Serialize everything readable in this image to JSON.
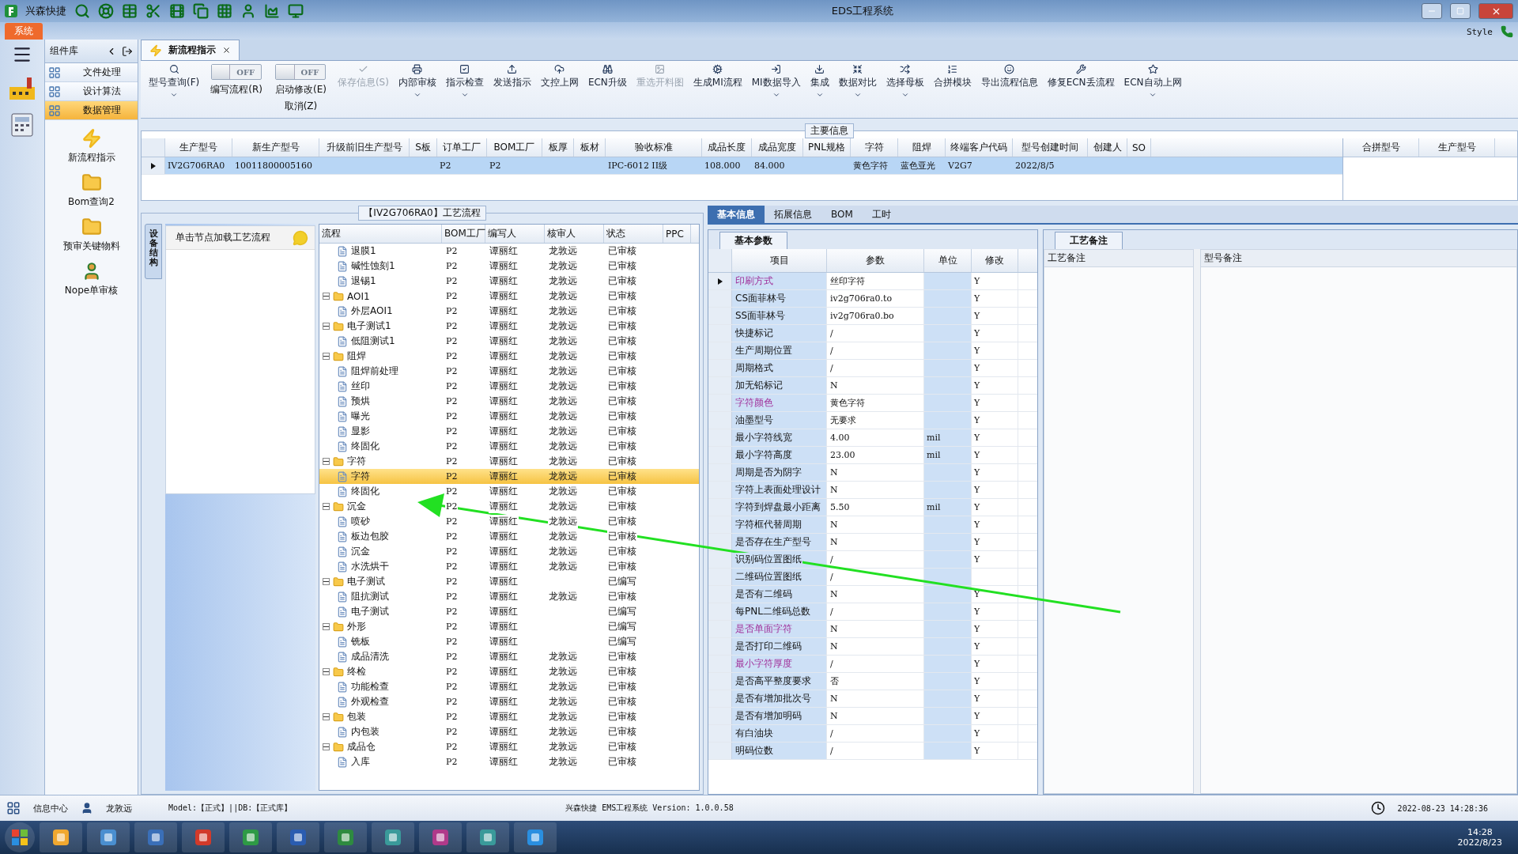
{
  "title_bar": {
    "app_name": "兴森快捷",
    "title": "EDS工程系统"
  },
  "ribbon": {
    "tab": "系统",
    "style_label": "Style"
  },
  "component_panel": {
    "title": "组件库",
    "menu": [
      {
        "label": "文件处理",
        "selected": false
      },
      {
        "label": "设计算法",
        "selected": false
      },
      {
        "label": "数据管理",
        "selected": true
      }
    ],
    "tools": [
      {
        "label": "新流程指示"
      },
      {
        "label": "Bom查询2"
      },
      {
        "label": "预审关键物料"
      },
      {
        "label": "Nope单审核"
      }
    ]
  },
  "doc_tab": {
    "label": "新流程指示"
  },
  "toolbar": [
    {
      "kind": "button",
      "label": "型号查询(F)",
      "dropdown": true,
      "disabled": false
    },
    {
      "kind": "toggle",
      "label": "编写流程(R)",
      "state_text": "OFF",
      "on": false
    },
    {
      "kind": "toggle",
      "label": "启动修改(E)",
      "sublabel": "取消(Z)",
      "state_text": "OFF",
      "on": false
    },
    {
      "kind": "button",
      "label": "保存信息(S)",
      "dropdown": false,
      "disabled": true
    },
    {
      "kind": "button",
      "label": "内部审核",
      "dropdown": true,
      "disabled": false
    },
    {
      "kind": "button",
      "label": "指示检查",
      "dropdown": true,
      "disabled": false
    },
    {
      "kind": "button",
      "label": "发送指示",
      "dropdown": false,
      "disabled": false
    },
    {
      "kind": "button",
      "label": "文控上网",
      "dropdown": false,
      "disabled": false
    },
    {
      "kind": "button",
      "label": "ECN升级",
      "dropdown": false,
      "disabled": false
    },
    {
      "kind": "button",
      "label": "重选开料图",
      "dropdown": false,
      "disabled": true
    },
    {
      "kind": "button",
      "label": "生成MI流程",
      "dropdown": false,
      "disabled": false
    },
    {
      "kind": "button",
      "label": "MI数据导入",
      "dropdown": true,
      "disabled": false
    },
    {
      "kind": "button",
      "label": "集成",
      "dropdown": true,
      "disabled": false
    },
    {
      "kind": "button",
      "label": "数据对比",
      "dropdown": true,
      "disabled": false
    },
    {
      "kind": "button",
      "label": "选择母板",
      "dropdown": true,
      "disabled": false
    },
    {
      "kind": "button",
      "label": "合拼模块",
      "dropdown": false,
      "disabled": false
    },
    {
      "kind": "button",
      "label": "导出流程信息",
      "dropdown": false,
      "disabled": false
    },
    {
      "kind": "button",
      "label": "修复ECN丢流程",
      "dropdown": false,
      "disabled": false
    },
    {
      "kind": "button",
      "label": "ECN自动上网",
      "dropdown": true,
      "disabled": false
    }
  ],
  "main_info": {
    "title": "主要信息",
    "columns": [
      "生产型号",
      "新生产型号",
      "升级前旧生产型号",
      "S板",
      "订单工厂",
      "BOM工厂",
      "板厚",
      "板材",
      "验收标准",
      "成品长度",
      "成品宽度",
      "PNL规格",
      "字符",
      "阻焊",
      "终端客户代码",
      "型号创建时间",
      "创建人",
      "SO"
    ],
    "rows": [
      {
        "selected": true,
        "cells": [
          "IV2G706RA0",
          "10011800005160",
          null,
          null,
          "P2",
          "P2",
          null,
          null,
          "IPC-6012 II级",
          "108.000",
          "84.000",
          null,
          "黄色字符",
          "蓝色亚光",
          "V2G7",
          "2022/8/5",
          null,
          null
        ]
      }
    ],
    "side_columns": [
      "合拼型号",
      "生产型号"
    ]
  },
  "process_panel": {
    "title": "【IV2G706RA0】工艺流程",
    "side_tab": "设备结构",
    "hint": "单击节点加载工艺流程",
    "columns": [
      "流程",
      "BOM工厂",
      "编写人",
      "核审人",
      "状态",
      "PPC"
    ],
    "nodes": [
      {
        "kind": "continuation",
        "children": [
          {
            "label": "退膜1",
            "bom": "P2",
            "writer": "谭丽红",
            "reviewer": "龙敦远",
            "status": "已审核",
            "selected": false
          },
          {
            "label": "碱性蚀刻1",
            "bom": "P2",
            "writer": "谭丽红",
            "reviewer": "龙敦远",
            "status": "已审核",
            "selected": false
          },
          {
            "label": "退锡1",
            "bom": "P2",
            "writer": "谭丽红",
            "reviewer": "龙敦远",
            "status": "已审核",
            "selected": false
          }
        ]
      },
      {
        "kind": "folder",
        "label": "AOI1",
        "bom": "P2",
        "writer": "谭丽红",
        "reviewer": "龙敦远",
        "status": "已审核",
        "selected": false,
        "expanded": true,
        "children": [
          {
            "label": "外层AOI1",
            "bom": "P2",
            "writer": "谭丽红",
            "reviewer": "龙敦远",
            "status": "已审核",
            "selected": false
          }
        ]
      },
      {
        "kind": "folder",
        "label": "电子测试1",
        "bom": "P2",
        "writer": "谭丽红",
        "reviewer": "龙敦远",
        "status": "已审核",
        "selected": false,
        "expanded": true,
        "children": [
          {
            "label": "低阻测试1",
            "bom": "P2",
            "writer": "谭丽红",
            "reviewer": "龙敦远",
            "status": "已审核",
            "selected": false
          }
        ]
      },
      {
        "kind": "folder",
        "label": "阻焊",
        "bom": "P2",
        "writer": "谭丽红",
        "reviewer": "龙敦远",
        "status": "已审核",
        "selected": false,
        "expanded": true,
        "children": [
          {
            "label": "阻焊前处理",
            "bom": "P2",
            "writer": "谭丽红",
            "reviewer": "龙敦远",
            "status": "已审核",
            "selected": false
          },
          {
            "label": "丝印",
            "bom": "P2",
            "writer": "谭丽红",
            "reviewer": "龙敦远",
            "status": "已审核",
            "selected": false
          },
          {
            "label": "预烘",
            "bom": "P2",
            "writer": "谭丽红",
            "reviewer": "龙敦远",
            "status": "已审核",
            "selected": false
          },
          {
            "label": "曝光",
            "bom": "P2",
            "writer": "谭丽红",
            "reviewer": "龙敦远",
            "status": "已审核",
            "selected": false
          },
          {
            "label": "显影",
            "bom": "P2",
            "writer": "谭丽红",
            "reviewer": "龙敦远",
            "status": "已审核",
            "selected": false
          },
          {
            "label": "终固化",
            "bom": "P2",
            "writer": "谭丽红",
            "reviewer": "龙敦远",
            "status": "已审核",
            "selected": false
          }
        ]
      },
      {
        "kind": "folder",
        "label": "字符",
        "bom": "P2",
        "writer": "谭丽红",
        "reviewer": "龙敦远",
        "status": "已审核",
        "selected": false,
        "expanded": true,
        "children": [
          {
            "label": "字符",
            "bom": "P2",
            "writer": "谭丽红",
            "reviewer": "龙敦远",
            "status": "已审核",
            "selected": true
          },
          {
            "label": "终固化",
            "bom": "P2",
            "writer": "谭丽红",
            "reviewer": "龙敦远",
            "status": "已审核",
            "selected": false
          }
        ]
      },
      {
        "kind": "folder",
        "label": "沉金",
        "bom": "P2",
        "writer": "谭丽红",
        "reviewer": "龙敦远",
        "status": "已审核",
        "selected": false,
        "expanded": true,
        "children": [
          {
            "label": "喷砂",
            "bom": "P2",
            "writer": "谭丽红",
            "reviewer": "龙敦远",
            "status": "已审核",
            "selected": false
          },
          {
            "label": "板边包胶",
            "bom": "P2",
            "writer": "谭丽红",
            "reviewer": "龙敦远",
            "status": "已审核",
            "selected": false
          },
          {
            "label": "沉金",
            "bom": "P2",
            "writer": "谭丽红",
            "reviewer": "龙敦远",
            "status": "已审核",
            "selected": false
          },
          {
            "label": "水洗烘干",
            "bom": "P2",
            "writer": "谭丽红",
            "reviewer": "龙敦远",
            "status": "已审核",
            "selected": false
          }
        ]
      },
      {
        "kind": "folder",
        "label": "电子测试",
        "bom": "P2",
        "writer": "谭丽红",
        "status": "已编写",
        "selected": false,
        "expanded": true,
        "children": [
          {
            "label": "阻抗测试",
            "bom": "P2",
            "writer": "谭丽红",
            "reviewer": "龙敦远",
            "status": "已审核",
            "selected": false
          },
          {
            "label": "电子测试",
            "bom": "P2",
            "writer": "谭丽红",
            "status": "已编写",
            "selected": false
          }
        ]
      },
      {
        "kind": "folder",
        "label": "外形",
        "bom": "P2",
        "writer": "谭丽红",
        "status": "已编写",
        "selected": false,
        "expanded": true,
        "children": [
          {
            "label": "铣板",
            "bom": "P2",
            "writer": "谭丽红",
            "status": "已编写",
            "selected": false
          },
          {
            "label": "成品清洗",
            "bom": "P2",
            "writer": "谭丽红",
            "reviewer": "龙敦远",
            "status": "已审核",
            "selected": false
          }
        ]
      },
      {
        "kind": "folder",
        "label": "终检",
        "bom": "P2",
        "writer": "谭丽红",
        "reviewer": "龙敦远",
        "status": "已审核",
        "selected": false,
        "expanded": true,
        "children": [
          {
            "label": "功能检查",
            "bom": "P2",
            "writer": "谭丽红",
            "reviewer": "龙敦远",
            "status": "已审核",
            "selected": false
          },
          {
            "label": "外观检查",
            "bom": "P2",
            "writer": "谭丽红",
            "reviewer": "龙敦远",
            "status": "已审核",
            "selected": false
          }
        ]
      },
      {
        "kind": "folder",
        "label": "包装",
        "bom": "P2",
        "writer": "谭丽红",
        "reviewer": "龙敦远",
        "status": "已审核",
        "selected": false,
        "expanded": true,
        "children": [
          {
            "label": "内包装",
            "bom": "P2",
            "writer": "谭丽红",
            "reviewer": "龙敦远",
            "status": "已审核",
            "selected": false
          }
        ]
      },
      {
        "kind": "folder",
        "label": "成品仓",
        "bom": "P2",
        "writer": "谭丽红",
        "reviewer": "龙敦远",
        "status": "已审核",
        "selected": false,
        "expanded": true,
        "children": [
          {
            "label": "入库",
            "bom": "P2",
            "writer": "谭丽红",
            "reviewer": "龙敦远",
            "status": "已审核",
            "selected": false
          }
        ]
      }
    ]
  },
  "detail_tabs": [
    {
      "label": "基本信息",
      "selected": true
    },
    {
      "label": "拓展信息",
      "selected": false
    },
    {
      "label": "BOM",
      "selected": false
    },
    {
      "label": "工时",
      "selected": false
    }
  ],
  "params_panel": {
    "title": "基本参数",
    "columns": [
      "项目",
      "参数",
      "单位",
      "修改"
    ],
    "rows": [
      {
        "item": "印刷方式",
        "value": "丝印字符",
        "modified": "Y",
        "emphasized": true,
        "selected": true
      },
      {
        "item": "CS面菲林号",
        "value": "iv2g706ra0.to",
        "modified": "Y",
        "emphasized": false,
        "selected": false
      },
      {
        "item": "SS面菲林号",
        "value": "iv2g706ra0.bo",
        "modified": "Y",
        "emphasized": false,
        "selected": false
      },
      {
        "item": "快捷标记",
        "value": "/",
        "modified": "Y",
        "emphasized": false,
        "selected": false
      },
      {
        "item": "生产周期位置",
        "value": "/",
        "modified": "Y",
        "emphasized": false,
        "selected": false
      },
      {
        "item": "周期格式",
        "value": "/",
        "modified": "Y",
        "emphasized": false,
        "selected": false
      },
      {
        "item": "加无铅标记",
        "value": "N",
        "modified": "Y",
        "emphasized": false,
        "selected": false
      },
      {
        "item": "字符颜色",
        "value": "黄色字符",
        "modified": "Y",
        "emphasized": true,
        "selected": false
      },
      {
        "item": "油墨型号",
        "value": "无要求",
        "modified": "Y",
        "emphasized": false,
        "selected": false
      },
      {
        "item": "最小字符线宽",
        "value": "4.00",
        "unit": "mil",
        "modified": "Y",
        "emphasized": false,
        "selected": false
      },
      {
        "item": "最小字符高度",
        "value": "23.00",
        "unit": "mil",
        "modified": "Y",
        "emphasized": false,
        "selected": false
      },
      {
        "item": "周期是否为阴字",
        "value": "N",
        "modified": "Y",
        "emphasized": false,
        "selected": false
      },
      {
        "item": "字符上表面处理设计",
        "value": "N",
        "modified": "Y",
        "emphasized": false,
        "selected": false
      },
      {
        "item": "字符到焊盘最小距离",
        "value": "5.50",
        "unit": "mil",
        "modified": "Y",
        "emphasized": false,
        "selected": false
      },
      {
        "item": "字符框代替周期",
        "value": "N",
        "modified": "Y",
        "emphasized": false,
        "selected": false
      },
      {
        "item": "是否存在生产型号",
        "value": "N",
        "modified": "Y",
        "emphasized": false,
        "selected": false
      },
      {
        "item": "识别码位置图纸",
        "value": "/",
        "modified": "Y",
        "emphasized": false,
        "selected": false
      },
      {
        "item": "二维码位置图纸",
        "value": "/",
        "emphasized": false,
        "selected": false
      },
      {
        "item": "是否有二维码",
        "value": "N",
        "modified": "Y",
        "emphasized": false,
        "selected": false
      },
      {
        "item": "每PNL二维码总数",
        "value": "/",
        "modified": "Y",
        "emphasized": false,
        "selected": false
      },
      {
        "item": "是否单面字符",
        "value": "N",
        "modified": "Y",
        "emphasized": true,
        "selected": false
      },
      {
        "item": "是否打印二维码",
        "value": "N",
        "modified": "Y",
        "emphasized": false,
        "selected": false
      },
      {
        "item": "最小字符厚度",
        "value": "/",
        "modified": "Y",
        "emphasized": true,
        "selected": false
      },
      {
        "item": "是否高平整度要求",
        "value": "否",
        "modified": "Y",
        "emphasized": false,
        "selected": false
      },
      {
        "item": "是否有增加批次号",
        "value": "N",
        "modified": "Y",
        "emphasized": false,
        "selected": false
      },
      {
        "item": "是否有增加明码",
        "value": "N",
        "modified": "Y",
        "emphasized": false,
        "selected": false
      },
      {
        "item": "有白油块",
        "value": "/",
        "modified": "Y",
        "emphasized": false,
        "selected": false
      },
      {
        "item": "明码位数",
        "value": "/",
        "modified": "Y",
        "emphasized": false,
        "selected": false
      }
    ]
  },
  "notes_panel": {
    "title": "工艺备注",
    "columns": [
      "工艺备注",
      "型号备注"
    ]
  },
  "status_bar": {
    "info_center": "信息中心",
    "user": "龙敦远",
    "model": "Model:【正式】||DB:【正式库】",
    "version": "兴森快捷 EMS工程系统 Version: 1.0.0.58",
    "datetime": "2022-08-23 14:28:36"
  },
  "taskbar": {
    "time": "14:28",
    "date": "2022/8/23"
  }
}
